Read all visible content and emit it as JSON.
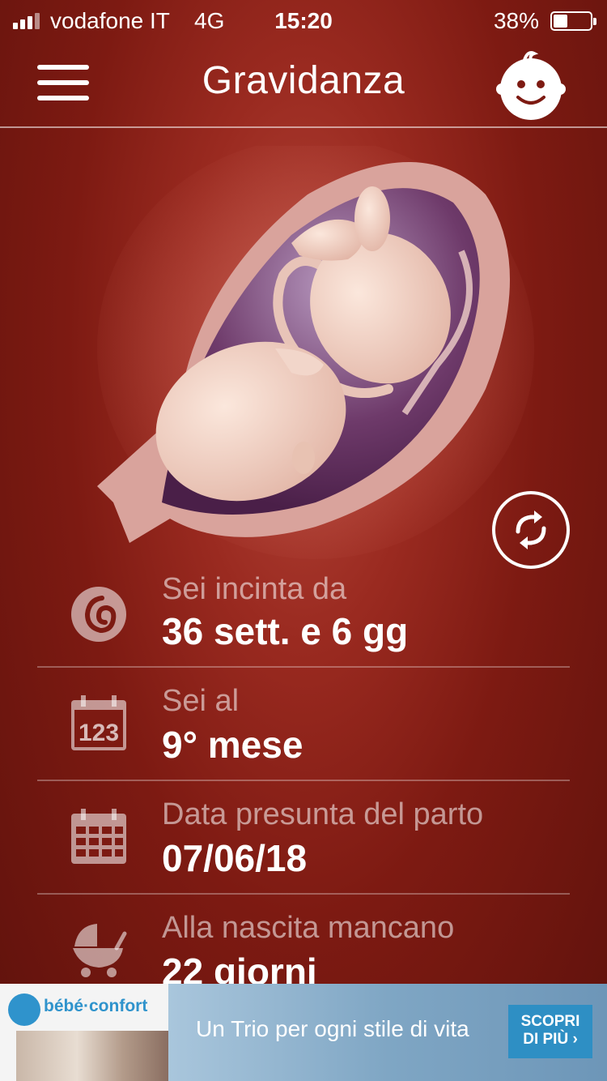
{
  "status_bar": {
    "carrier": "vodafone IT",
    "network": "4G",
    "time": "15:20",
    "battery": "38%",
    "battery_level": 0.38
  },
  "header": {
    "title": "Gravidanza",
    "menu_icon": "hamburger-menu-icon",
    "profile_icon": "baby-face-icon"
  },
  "illustration": {
    "subject": "fetus-in-womb-illustration",
    "refresh_icon": "refresh-icon"
  },
  "info": [
    {
      "icon": "fetus-icon",
      "label": "Sei incinta da",
      "value": "36 sett. e 6 gg"
    },
    {
      "icon": "calendar-123-icon",
      "label": "Sei al",
      "value": "9° mese"
    },
    {
      "icon": "calendar-icon",
      "label": "Data presunta del parto",
      "value": "07/06/18"
    },
    {
      "icon": "stroller-icon",
      "label": "Alla nascita mancano",
      "value": "22 giorni"
    }
  ],
  "ad": {
    "brand": "bébé·confort",
    "tagline": "Un Trio per ogni stile di vita",
    "cta_line1": "SCOPRI",
    "cta_line2": "DI PIÙ ›"
  },
  "colors": {
    "background": "#7d1a12",
    "accent": "#b5463a",
    "ad_blue": "#2e8fc4"
  }
}
